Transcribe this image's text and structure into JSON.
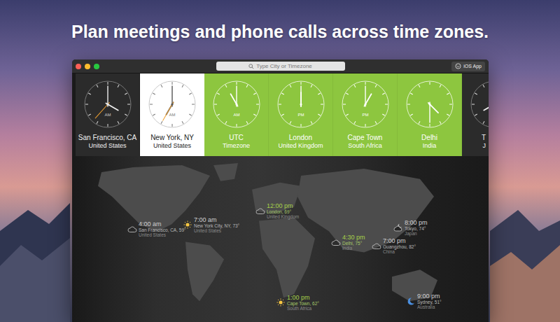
{
  "headline": "Plan meetings and phone calls across time zones.",
  "window": {
    "search": {
      "placeholder": "Type City or Timezone"
    },
    "button": {
      "label": "iOS App"
    }
  },
  "clocks": [
    {
      "city": "San Francisco, CA",
      "subtitle": "United States",
      "ampm": "AM",
      "hour": 4,
      "minute": 0,
      "second": 37,
      "selected": false,
      "highlighted": false
    },
    {
      "city": "New York, NY",
      "subtitle": "United States",
      "ampm": "AM",
      "hour": 7,
      "minute": 0,
      "second": 35,
      "selected": true,
      "highlighted": false
    },
    {
      "city": "UTC",
      "subtitle": "Timezone",
      "ampm": "AM",
      "hour": 11,
      "minute": 0,
      "second": null,
      "selected": false,
      "highlighted": true
    },
    {
      "city": "London",
      "subtitle": "United Kingdom",
      "ampm": "PM",
      "hour": 12,
      "minute": 0,
      "second": null,
      "selected": false,
      "highlighted": true
    },
    {
      "city": "Cape Town",
      "subtitle": "South Africa",
      "ampm": "PM",
      "hour": 1,
      "minute": 0,
      "second": null,
      "selected": false,
      "highlighted": true
    },
    {
      "city": "Delhi",
      "subtitle": "India",
      "ampm": "",
      "hour": 4,
      "minute": 30,
      "second": null,
      "selected": false,
      "highlighted": true
    },
    {
      "city": "T",
      "subtitle": "J",
      "ampm": "",
      "hour": 8,
      "minute": 0,
      "second": null,
      "selected": false,
      "highlighted": false
    }
  ],
  "pins": [
    {
      "time": "4:00 am",
      "city": "San Francisco, CA, 59°",
      "country": "United States",
      "weather": "cloud",
      "highlighted": false
    },
    {
      "time": "7:00 am",
      "city": "New York City, NY, 73°",
      "country": "United States",
      "weather": "sun",
      "highlighted": false
    },
    {
      "time": "12:00 pm",
      "city": "London, 69°",
      "country": "United Kingdom",
      "weather": "cloud",
      "highlighted": true
    },
    {
      "time": "4:30 pm",
      "city": "Delhi, 75°",
      "country": "India",
      "weather": "cloud",
      "highlighted": true
    },
    {
      "time": "8:00 pm",
      "city": "Tokyo, 74°",
      "country": "Japan",
      "weather": "cloud-moon",
      "highlighted": false
    },
    {
      "time": "7:00 pm",
      "city": "Guangzhou, 82°",
      "country": "China",
      "weather": "cloud",
      "highlighted": false
    },
    {
      "time": "1:00 pm",
      "city": "Cape Town, 62°",
      "country": "South Africa",
      "weather": "sun",
      "highlighted": true
    },
    {
      "time": "9:00 pm",
      "city": "Sydney, 51°",
      "country": "Australia",
      "weather": "moon",
      "highlighted": false
    }
  ]
}
